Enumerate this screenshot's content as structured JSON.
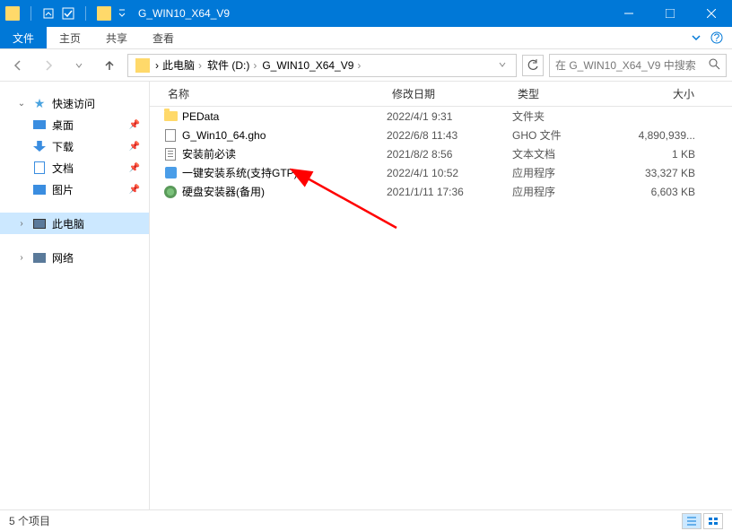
{
  "title": "G_WIN10_X64_V9",
  "ribbon": {
    "file": "文件",
    "tabs": [
      "主页",
      "共享",
      "查看"
    ]
  },
  "breadcrumb": [
    {
      "label": "此电脑"
    },
    {
      "label": "软件 (D:)"
    },
    {
      "label": "G_WIN10_X64_V9"
    }
  ],
  "search_placeholder": "在 G_WIN10_X64_V9 中搜索",
  "columns": {
    "name": "名称",
    "date": "修改日期",
    "type": "类型",
    "size": "大小"
  },
  "nav": {
    "quick": "快速访问",
    "items": [
      {
        "label": "桌面",
        "icon": "desk",
        "pin": true
      },
      {
        "label": "下载",
        "icon": "down",
        "pin": true
      },
      {
        "label": "文档",
        "icon": "doc",
        "pin": true
      },
      {
        "label": "图片",
        "icon": "pic",
        "pin": true
      }
    ],
    "pc": "此电脑",
    "net": "网络"
  },
  "files": [
    {
      "name": "PEData",
      "date": "2022/4/1 9:31",
      "type": "文件夹",
      "size": "",
      "icon": "folder"
    },
    {
      "name": "G_Win10_64.gho",
      "date": "2022/6/8 11:43",
      "type": "GHO 文件",
      "size": "4,890,939...",
      "icon": "file"
    },
    {
      "name": "安装前必读",
      "date": "2021/8/2 8:56",
      "type": "文本文档",
      "size": "1 KB",
      "icon": "txt"
    },
    {
      "name": "一键安装系统(支持GTP)",
      "date": "2022/4/1 10:52",
      "type": "应用程序",
      "size": "33,327 KB",
      "icon": "app"
    },
    {
      "name": "硬盘安装器(备用)",
      "date": "2021/1/11 17:36",
      "type": "应用程序",
      "size": "6,603 KB",
      "icon": "disk"
    }
  ],
  "status": "5 个项目"
}
